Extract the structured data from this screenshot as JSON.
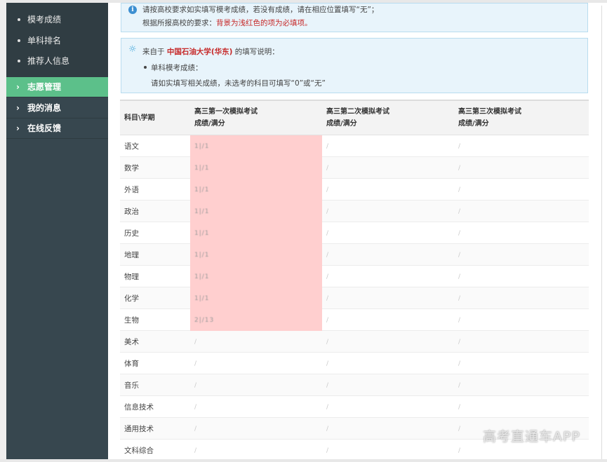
{
  "sidebar": {
    "sub_items": [
      {
        "label": "模考成绩"
      },
      {
        "label": "单科排名"
      },
      {
        "label": "推荐人信息"
      }
    ],
    "nav_items": [
      {
        "label": "志愿管理",
        "active": true
      },
      {
        "label": "我的消息",
        "active": false
      },
      {
        "label": "在线反馈",
        "active": false
      }
    ],
    "chevron": "›",
    "colors": {
      "bg": "#37474f",
      "active": "#5cc08a"
    }
  },
  "notice1": {
    "icon": "info-icon",
    "line1": "请按高校要求如实填写模考成绩，若没有成绩，请在相应位置填写“无”；",
    "line2_prefix": "根据所报高校的要求：",
    "line2_red": "背景为浅红色的项为必填项。"
  },
  "notice2": {
    "icon": "lightbulb-icon",
    "prefix": "来自于",
    "school": "中国石油大学(华东)",
    "suffix": "的填写说明：",
    "bullet_title": "单科模考成绩：",
    "detail": "请如实填写相关成绩，未选考的科目可填写“0”或“无”"
  },
  "table": {
    "corner": "科目\\学期",
    "headers": [
      {
        "line1": "高三第一次模拟考试",
        "line2": "成绩/满分"
      },
      {
        "line1": "高三第二次模拟考试",
        "line2": "成绩/满分"
      },
      {
        "line1": "高三第三次模拟考试",
        "line2": "成绩/满分"
      }
    ],
    "rows": [
      {
        "subject": "语文",
        "required": true,
        "v1": "1|/1",
        "v2": "/",
        "v3": "/"
      },
      {
        "subject": "数学",
        "required": true,
        "v1": "1|/1",
        "v2": "/",
        "v3": "/"
      },
      {
        "subject": "外语",
        "required": true,
        "v1": "1|/1",
        "v2": "/",
        "v3": "/"
      },
      {
        "subject": "政治",
        "required": true,
        "v1": "1|/1",
        "v2": "/",
        "v3": "/"
      },
      {
        "subject": "历史",
        "required": true,
        "v1": "1|/1",
        "v2": "/",
        "v3": "/"
      },
      {
        "subject": "地理",
        "required": true,
        "v1": "1|/1",
        "v2": "/",
        "v3": "/"
      },
      {
        "subject": "物理",
        "required": true,
        "v1": "1|/1",
        "v2": "/",
        "v3": "/"
      },
      {
        "subject": "化学",
        "required": true,
        "v1": "1|/1",
        "v2": "/",
        "v3": "/"
      },
      {
        "subject": "生物",
        "required": true,
        "v1": "2|/13",
        "v2": "/",
        "v3": "/"
      },
      {
        "subject": "美术",
        "required": false,
        "v1": "/",
        "v2": "/",
        "v3": "/"
      },
      {
        "subject": "体育",
        "required": false,
        "v1": "/",
        "v2": "/",
        "v3": "/"
      },
      {
        "subject": "音乐",
        "required": false,
        "v1": "/",
        "v2": "/",
        "v3": "/"
      },
      {
        "subject": "信息技术",
        "required": false,
        "v1": "/",
        "v2": "/",
        "v3": "/"
      },
      {
        "subject": "通用技术",
        "required": false,
        "v1": "/",
        "v2": "/",
        "v3": "/"
      },
      {
        "subject": "文科综合",
        "required": false,
        "v1": "/",
        "v2": "/",
        "v3": "/"
      }
    ],
    "required_color": "#ffcfcf"
  },
  "watermark": "高考直通车APP"
}
